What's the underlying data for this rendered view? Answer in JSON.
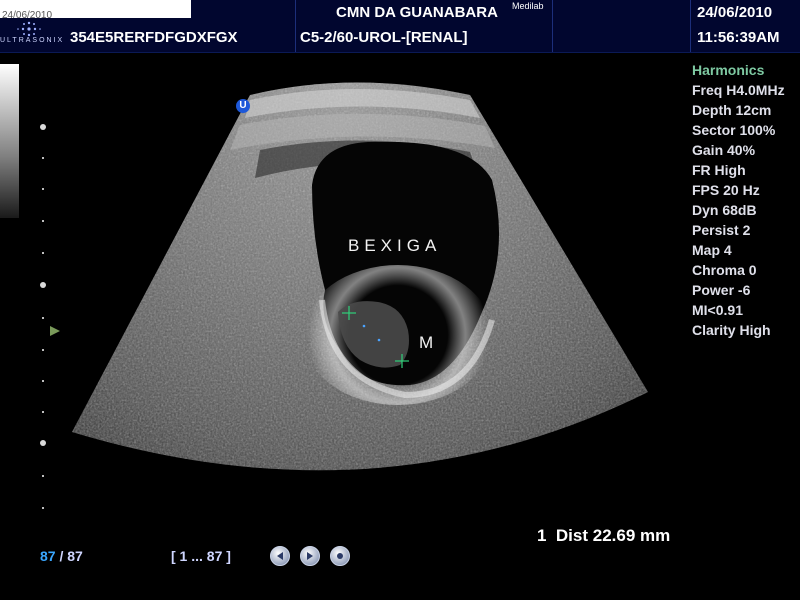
{
  "header": {
    "date_small": "24/06/2010",
    "logo_text": "ULTRASONIX",
    "patient_id": "354E5RERFDFGDXFGX",
    "clinic": "CMN DA GUANABARA",
    "clinic_superscript": "Medilab",
    "preset": "C5-2/60-UROL-[RENAL]",
    "date": "24/06/2010",
    "time": "11:56:39AM"
  },
  "image": {
    "orientation_marker": "U",
    "labels": {
      "bladder": "BEXIGA",
      "mass": "M"
    }
  },
  "parameters": [
    "Harmonics",
    "Freq H4.0MHz",
    "Depth 12cm",
    "Sector 100%",
    "Gain 40%",
    "FR High",
    "FPS 20 Hz",
    "Dyn 68dB",
    "Persist 2",
    "Map 4",
    "Chroma 0",
    "Power -6",
    "MI<0.91",
    "Clarity High"
  ],
  "measurement": "1  Dist 22.69 mm",
  "cine": {
    "current_frame": "87",
    "separator": " / ",
    "total_frames": "87",
    "range": "[ 1 ... 87 ]"
  },
  "colors": {
    "header_bg": "#01062f",
    "harmonics": "#7ec9a2",
    "frame_current": "#3aa7ff",
    "caliper": "#2fd07a",
    "orientation_marker": "#1d58d9"
  },
  "icons": {
    "cine_buttons": [
      "rewind-icon",
      "play-icon",
      "stop-icon"
    ]
  }
}
